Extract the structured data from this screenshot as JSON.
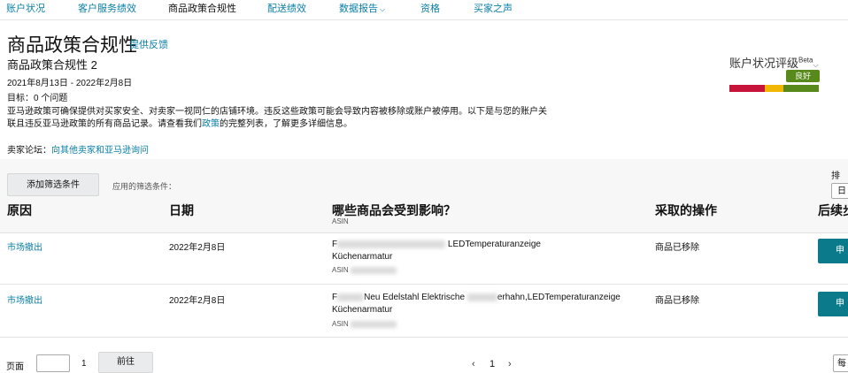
{
  "nav": {
    "tabs": [
      {
        "label": "账户状况"
      },
      {
        "label": "客户服务绩效"
      },
      {
        "label": "商品政策合规性"
      },
      {
        "label": "配送绩效"
      },
      {
        "label": "数据报告"
      },
      {
        "label": "资格"
      },
      {
        "label": "买家之声"
      }
    ],
    "active_index": 2
  },
  "header": {
    "title": "商品政策合规性",
    "feedback": "提供反馈",
    "subtitle": "商品政策合规性 2",
    "date_range": "2021年8月13日 - 2022年2月8日",
    "goal": "目标：0 个问题",
    "description_1": "亚马逊政策可确保提供对买家安全、对卖家一视同仁的店铺环境。违反这些政策可能会导致内容被移除或账户被停用。以下是与您的账户关",
    "description_2a": "联且违反亚马逊政策的所有商品记录。请查看我们",
    "description_link": "政策",
    "description_2b": "的完整列表，了解更多详细信息。",
    "forum_label": "卖家论坛：",
    "forum_link": "向其他卖家和亚马逊询问"
  },
  "account_health": {
    "label": "账户状况评级",
    "beta": "Beta",
    "badge": "良好",
    "colors": [
      "#c7143b",
      "#c7143b",
      "#f2b705",
      "#578a1a",
      "#578a1a"
    ]
  },
  "filters": {
    "add_button": "添加筛选条件",
    "applied_label": "应用的筛选条件：",
    "sort_label": "排序",
    "sort_value": "日"
  },
  "table": {
    "headers": {
      "reason": "原因",
      "date": "日期",
      "affected": "哪些商品会受到影响？",
      "affected_sub": "ASIN",
      "action": "采取的操作",
      "followup": "后续步"
    },
    "rows": [
      {
        "reason": "市场撤出",
        "date": "2022年2月8日",
        "title_head": "F",
        "title_tail": "LEDTemperaturanzeige",
        "title_line2": "Küchenarmatur",
        "asin_label": "ASIN",
        "action": "商品已移除",
        "button": "申"
      },
      {
        "reason": "市场撤出",
        "date": "2022年2月8日",
        "title_head": "F",
        "title_mid": "Neu Edelstahl Elektrische",
        "title_tail": "erhahn,LEDTemperaturanzeige",
        "title_line2": "Küchenarmatur",
        "asin_label": "ASIN",
        "action": "商品已移除",
        "button": "申"
      }
    ]
  },
  "pagination": {
    "label": "页面",
    "total": "1",
    "go": "前往",
    "prev": "‹",
    "current": "1",
    "next": "›",
    "per_page": "每"
  }
}
